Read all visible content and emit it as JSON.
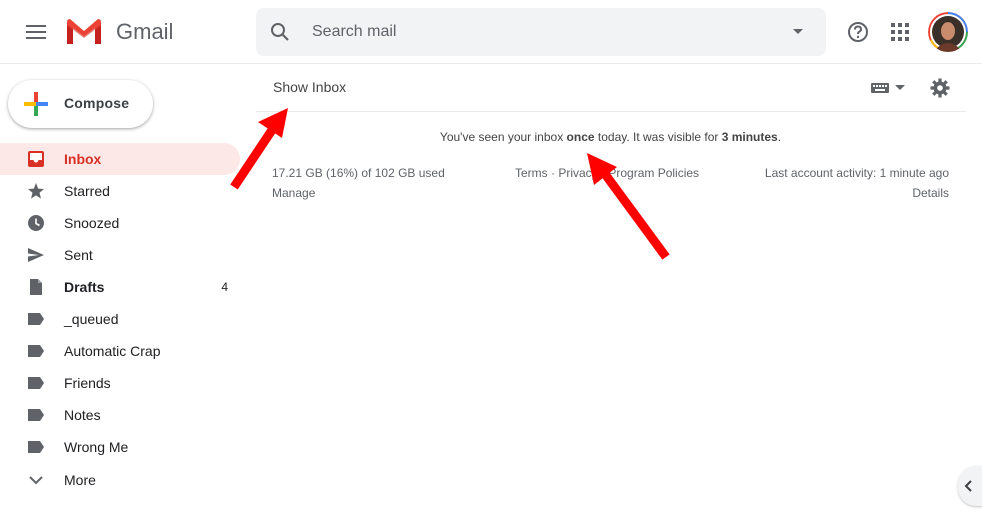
{
  "header": {
    "app_name": "Gmail",
    "search_placeholder": "Search mail"
  },
  "compose": {
    "label": "Compose"
  },
  "nav": {
    "items": [
      {
        "label": "Inbox",
        "icon": "inbox-icon",
        "active": true
      },
      {
        "label": "Starred",
        "icon": "star-icon"
      },
      {
        "label": "Snoozed",
        "icon": "clock-icon"
      },
      {
        "label": "Sent",
        "icon": "send-icon"
      },
      {
        "label": "Drafts",
        "icon": "draft-icon",
        "count": "4"
      },
      {
        "label": "_queued",
        "icon": "label-icon"
      },
      {
        "label": "Automatic Crap",
        "icon": "label-icon"
      },
      {
        "label": "Friends",
        "icon": "label-icon"
      },
      {
        "label": "Notes",
        "icon": "label-icon"
      },
      {
        "label": "Wrong Me",
        "icon": "label-icon"
      },
      {
        "label": "More",
        "icon": "chevron-down-icon"
      }
    ]
  },
  "main": {
    "show_inbox": "Show Inbox",
    "seen": {
      "prefix": "You've seen your inbox ",
      "count": "once",
      "middle": " today. It was visible for ",
      "duration": "3 minutes",
      "suffix": "."
    }
  },
  "footer": {
    "storage": "17.21 GB (16%) of 102 GB used",
    "manage": "Manage",
    "terms": "Terms",
    "privacy": "Privacy",
    "program_policies": "Program Policies",
    "separator": " · ",
    "activity": "Last account activity: 1 minute ago",
    "details": "Details"
  },
  "colors": {
    "brand_red": "#d93025",
    "active_bg": "#fce8e6",
    "annotation_arrow": "#ff0000"
  }
}
